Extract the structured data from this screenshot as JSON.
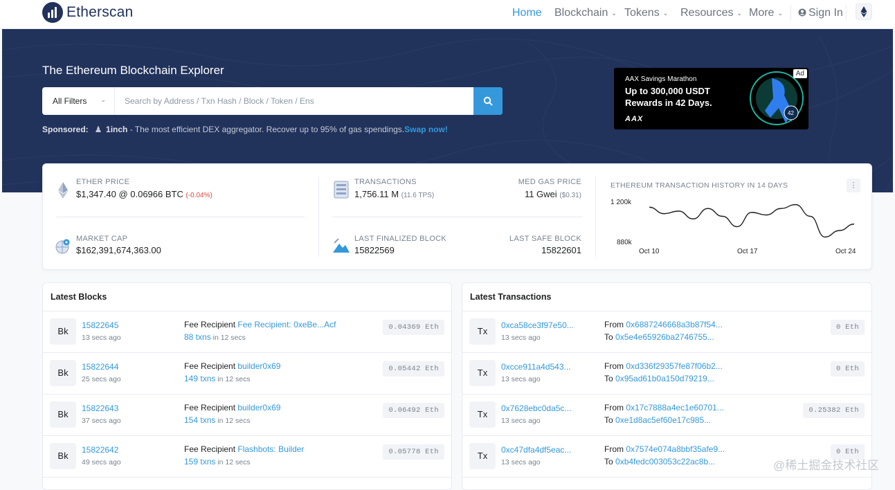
{
  "header": {
    "logo_text": "Etherscan",
    "nav": {
      "home": "Home",
      "blockchain": "Blockchain",
      "tokens": "Tokens",
      "resources": "Resources",
      "more": "More",
      "signin": "Sign In"
    }
  },
  "hero": {
    "title": "The Ethereum Blockchain Explorer",
    "filter_label": "All Filters",
    "search_placeholder": "Search by Address / Txn Hash / Block / Token / Ens",
    "sponsored_label": "Sponsored:",
    "sponsored_name": "1inch",
    "sponsored_text": " - The most efficient DEX aggregator. Recover up to 95% of gas spendings.",
    "sponsored_link": "Swap now!",
    "ad": {
      "small": "AAX Savings Marathon",
      "big": "Up to 300,000 USDT Rewards in 42 Days.",
      "brand": "AAX",
      "tag": "Ad"
    }
  },
  "stats": {
    "ether_price_label": "ETHER PRICE",
    "ether_price_value": "$1,347.40 @ 0.06966 BTC",
    "ether_price_change": "(-0.04%)",
    "market_cap_label": "MARKET CAP",
    "market_cap_value": "$162,391,674,363.00",
    "transactions_label": "TRANSACTIONS",
    "transactions_value": "1,756.11 M",
    "transactions_tps": "(11.6 TPS)",
    "gas_label": "MED GAS PRICE",
    "gas_value": "11 Gwei",
    "gas_usd": "($0.31)",
    "finalized_label": "LAST FINALIZED BLOCK",
    "finalized_value": "15822569",
    "safe_label": "LAST SAFE BLOCK",
    "safe_value": "15822601",
    "chart_title": "ETHEREUM TRANSACTION HISTORY IN 14 DAYS"
  },
  "chart_data": {
    "type": "line",
    "title": "ETHEREUM TRANSACTION HISTORY IN 14 DAYS",
    "x": [
      "Oct 10",
      "Oct 11",
      "Oct 12",
      "Oct 13",
      "Oct 14",
      "Oct 15",
      "Oct 16",
      "Oct 17",
      "Oct 18",
      "Oct 19",
      "Oct 20",
      "Oct 21",
      "Oct 22",
      "Oct 23",
      "Oct 24"
    ],
    "x_ticks": [
      "Oct 10",
      "Oct 17",
      "Oct 24"
    ],
    "y_ticks": [
      "1 200k",
      "880k"
    ],
    "series": [
      {
        "values": [
          1150000,
          1100000,
          1120000,
          1060000,
          1140000,
          1080000,
          1000000,
          1110000,
          1090000,
          1140000,
          1170000,
          1080000,
          920000,
          970000,
          1020000
        ]
      }
    ],
    "ylim": [
      880000,
      1200000
    ],
    "grid": false
  },
  "blocks": {
    "title": "Latest Blocks",
    "badge": "Bk",
    "fee_label": "Fee Recipient",
    "in_text": "in 12 secs",
    "items": [
      {
        "number": "15822645",
        "age": "13 secs ago",
        "recipient": "Fee Recipient: 0xeBe...Acf",
        "txns": "88 txns",
        "amount": "0.04369 Eth"
      },
      {
        "number": "15822644",
        "age": "25 secs ago",
        "recipient": "builder0x69",
        "txns": "149 txns",
        "amount": "0.05442 Eth"
      },
      {
        "number": "15822643",
        "age": "37 secs ago",
        "recipient": "builder0x69",
        "txns": "154 txns",
        "amount": "0.06492 Eth"
      },
      {
        "number": "15822642",
        "age": "49 secs ago",
        "recipient": "Flashbots: Builder",
        "txns": "159 txns",
        "amount": "0.05778 Eth"
      }
    ]
  },
  "transactions": {
    "title": "Latest Transactions",
    "badge": "Tx",
    "from_label": "From",
    "to_label": "To",
    "items": [
      {
        "hash": "0xca58ce3f97e50...",
        "age": "13 secs ago",
        "from": "0x6887246668a3b87f54...",
        "to": "0x5e4e65926ba2746755...",
        "amount": "0 Eth"
      },
      {
        "hash": "0xcce911a4d543...",
        "age": "13 secs ago",
        "from": "0xd336f29357fe87f06b2...",
        "to": "0x95ad61b0a150d79219...",
        "amount": "0 Eth"
      },
      {
        "hash": "0x7628ebc0da5c...",
        "age": "13 secs ago",
        "from": "0x17c7888a4ec1e60701...",
        "to": "0xe1d8ac5ef60e17c985...",
        "amount": "0.25382 Eth"
      },
      {
        "hash": "0xc47dfa4df5eac...",
        "age": "13 secs ago",
        "from": "0x7574e074a8bbf35afe9...",
        "to": "0xb4fedc003053c22ac8b...",
        "amount": "0 Eth"
      }
    ]
  },
  "watermark": "@稀土掘金技术社区",
  "colors": {
    "brand": "#21325b",
    "accent": "#3498db",
    "negative": "#de4437"
  }
}
